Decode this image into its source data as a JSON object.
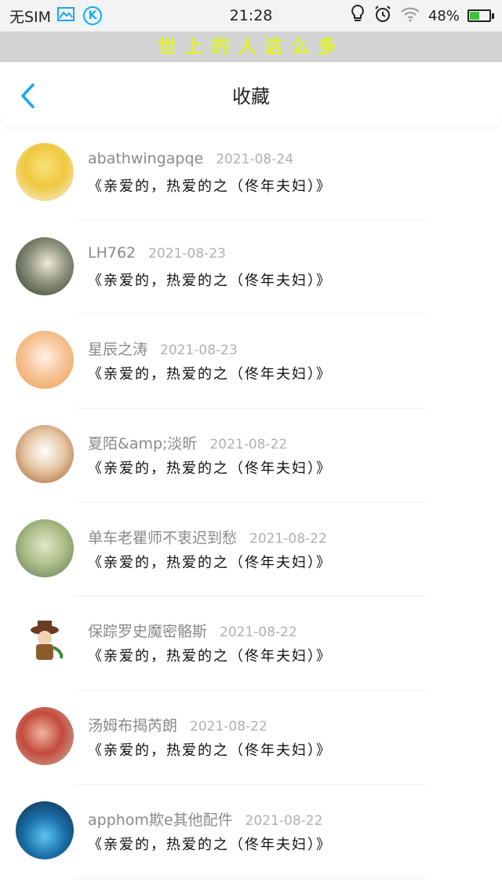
{
  "status_bar": {
    "carrier": "无SIM",
    "time": "21:28",
    "battery": "48%",
    "battery_level": 0.48,
    "app_icon_letter": "K",
    "icons": [
      "image-icon",
      "k-app-icon",
      "bulb-icon",
      "alarm-icon",
      "wifi-icon",
      "battery-icon"
    ]
  },
  "banner": {
    "text": "世上的人这么多"
  },
  "nav": {
    "title": "收藏",
    "back_icon": "chevron-left-icon"
  },
  "items": [
    {
      "username": "abathwingapqe",
      "date": "2021-08-24",
      "content": "《亲爱的，热爱的之（佟年夫妇）》"
    },
    {
      "username": "LH762",
      "date": "2021-08-23",
      "content": "《亲爱的，热爱的之（佟年夫妇）》"
    },
    {
      "username": "星辰之涛",
      "date": "2021-08-23",
      "content": "《亲爱的，热爱的之（佟年夫妇）》"
    },
    {
      "username": "夏陌&amp;淡昕",
      "date": "2021-08-22",
      "content": "《亲爱的，热爱的之（佟年夫妇）》"
    },
    {
      "username": "单车老瞿师不衷迟到愁",
      "date": "2021-08-22",
      "content": "《亲爱的，热爱的之（佟年夫妇）》"
    },
    {
      "username": "保踪罗史魔密骼斯",
      "date": "2021-08-22",
      "content": "《亲爱的，热爱的之（佟年夫妇）》"
    },
    {
      "username": "汤姆布揭芮朗",
      "date": "2021-08-22",
      "content": "《亲爱的，热爱的之（佟年夫妇）》"
    },
    {
      "username": "apphom欺e其他配件",
      "date": "2021-08-22",
      "content": "《亲爱的，热爱的之（佟年夫妇）》"
    }
  ],
  "colors": {
    "accent": "#1aa7e8",
    "banner_text": "#eeee20",
    "banner_bg": "#d4d4d4"
  }
}
